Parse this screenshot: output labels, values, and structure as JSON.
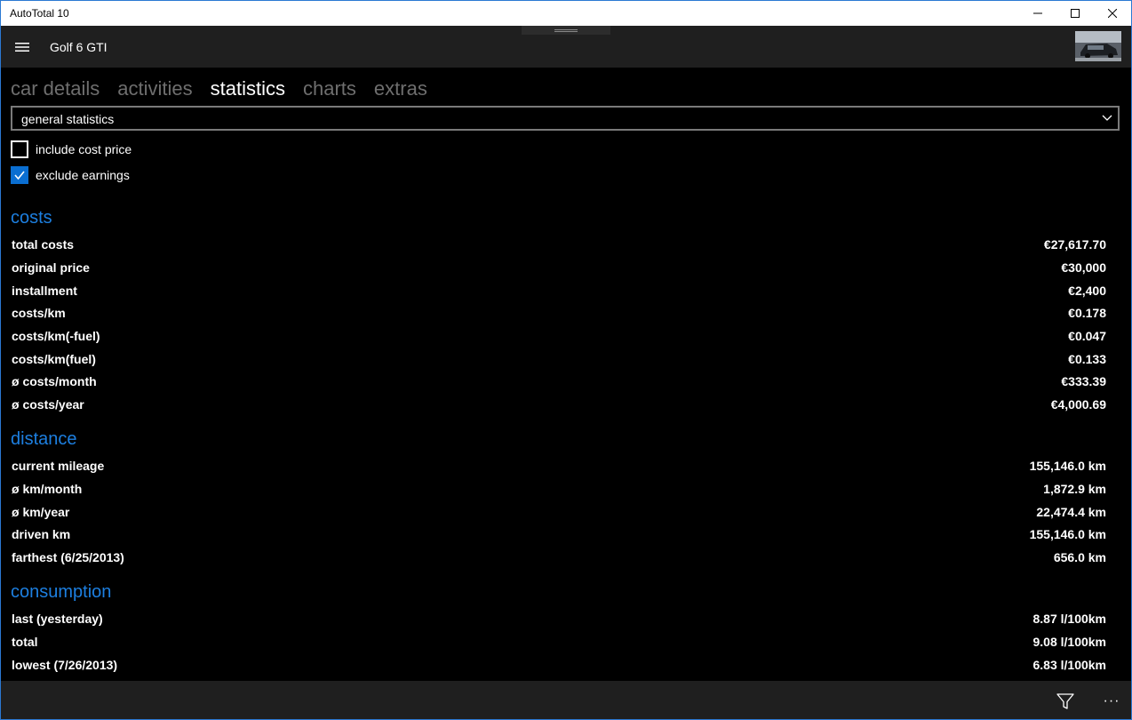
{
  "window": {
    "title": "AutoTotal 10"
  },
  "header": {
    "car_name": "Golf 6 GTI"
  },
  "tabs": [
    {
      "label": "car details",
      "active": false
    },
    {
      "label": "activities",
      "active": false
    },
    {
      "label": "statistics",
      "active": true
    },
    {
      "label": "charts",
      "active": false
    },
    {
      "label": "extras",
      "active": false
    }
  ],
  "dropdown": {
    "selected": "general statistics"
  },
  "options": {
    "include_cost_price": {
      "label": "include cost price",
      "checked": false
    },
    "exclude_earnings": {
      "label": "exclude earnings",
      "checked": true
    }
  },
  "sections": {
    "costs": {
      "title": "costs",
      "rows": [
        {
          "label": "total costs",
          "value": "€27,617.70"
        },
        {
          "label": "original price",
          "value": "€30,000"
        },
        {
          "label": "installment",
          "value": "€2,400"
        },
        {
          "label": "costs/km",
          "value": "€0.178"
        },
        {
          "label": "costs/km(-fuel)",
          "value": "€0.047"
        },
        {
          "label": "costs/km(fuel)",
          "value": "€0.133"
        },
        {
          "label": "ø costs/month",
          "value": "€333.39"
        },
        {
          "label": "ø costs/year",
          "value": "€4,000.69"
        }
      ]
    },
    "distance": {
      "title": "distance",
      "rows": [
        {
          "label": "current mileage",
          "value": "155,146.0 km"
        },
        {
          "label": "ø km/month",
          "value": "1,872.9 km"
        },
        {
          "label": "ø km/year",
          "value": "22,474.4 km"
        },
        {
          "label": "driven km",
          "value": "155,146.0 km"
        },
        {
          "label": "farthest (6/25/2013)",
          "value": "656.0 km"
        }
      ]
    },
    "consumption": {
      "title": "consumption",
      "rows": [
        {
          "label": "last (yesterday)",
          "value": "8.87 l/100km"
        },
        {
          "label": "total",
          "value": "9.08 l/100km"
        },
        {
          "label": "lowest (7/26/2013)",
          "value": "6.83 l/100km"
        }
      ]
    }
  },
  "bottombar": {
    "more_label": "···"
  },
  "colors": {
    "accent": "#1d7fe0",
    "checkbox": "#0a6ed1",
    "background": "#000000",
    "bar": "#1f1f1f"
  }
}
